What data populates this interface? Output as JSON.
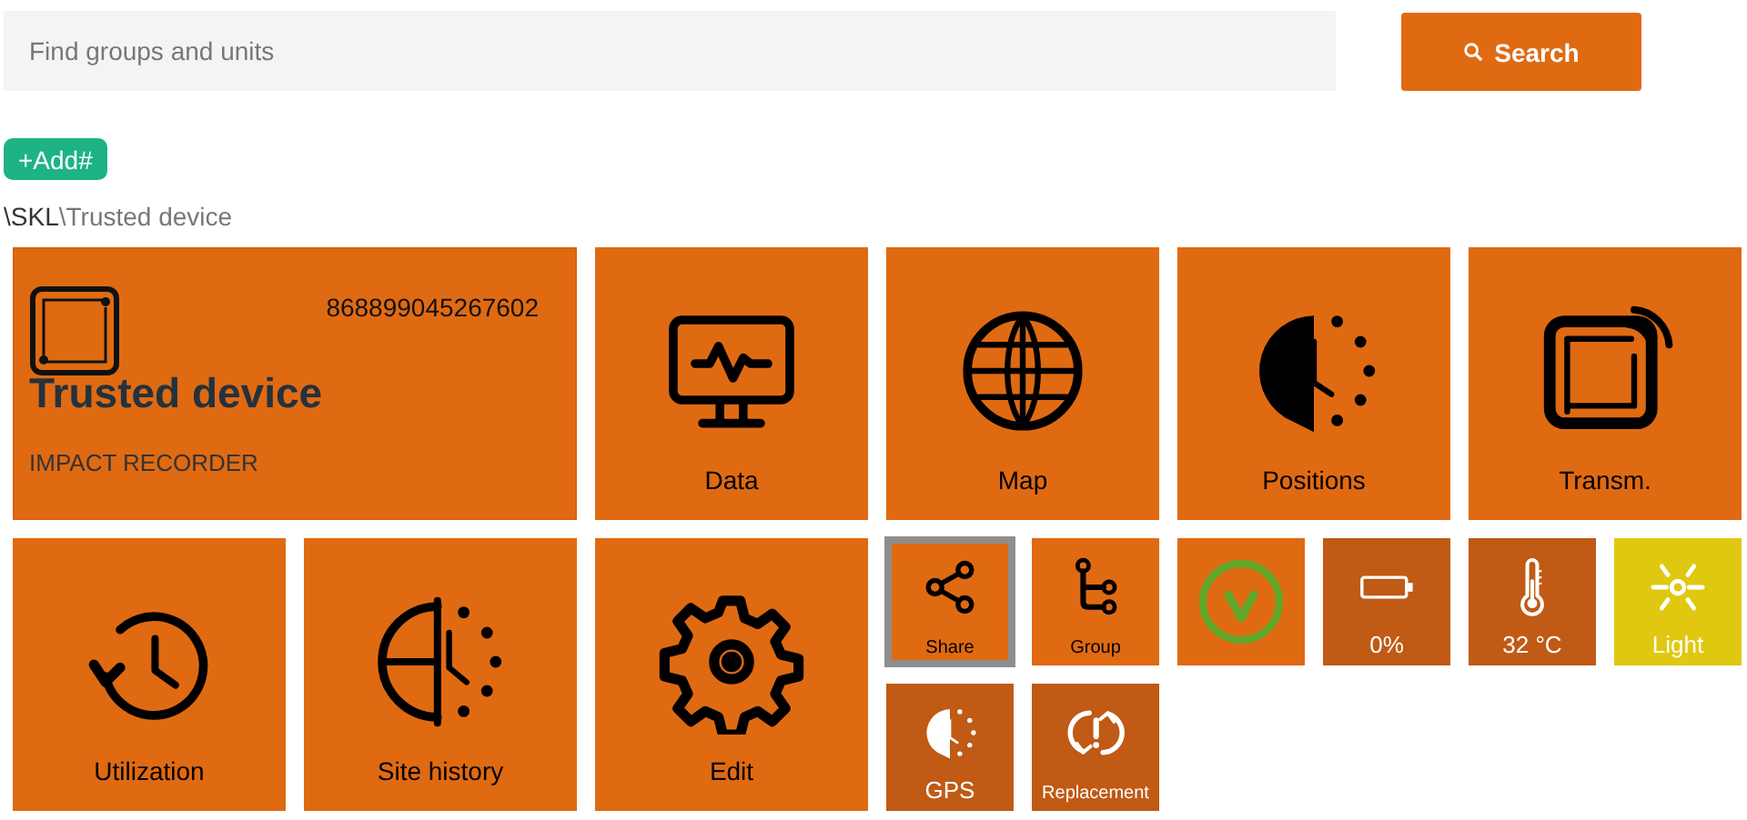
{
  "search": {
    "placeholder": "Find groups and units",
    "button": "Search"
  },
  "add_button": "+Add#",
  "breadcrumb": [
    {
      "label": "\\SKL",
      "selected": false
    },
    {
      "label": "\\Trusted device",
      "selected": true
    }
  ],
  "device": {
    "serial": "868899045267602",
    "name": "Trusted device",
    "type": "IMPACT RECORDER"
  },
  "tiles": [
    {
      "label": "Data",
      "kind": "large",
      "color": "#e06a12",
      "selected": false
    },
    {
      "label": "Map",
      "kind": "large",
      "color": "#e06a12",
      "selected": false
    },
    {
      "label": "Positions",
      "kind": "large",
      "color": "#e06a12",
      "selected": false
    },
    {
      "label": "Transm.",
      "kind": "large",
      "color": "#e06a12",
      "selected": false
    },
    {
      "label": "Utilization",
      "kind": "large",
      "color": "#e06a12",
      "selected": false
    },
    {
      "label": "Site history",
      "kind": "large",
      "color": "#e06a12",
      "selected": false
    },
    {
      "label": "Edit",
      "kind": "large",
      "color": "#e06a12",
      "selected": false
    },
    {
      "label": "Share",
      "kind": "small",
      "color": "#e06a12",
      "selected": true
    },
    {
      "label": "Group",
      "kind": "small",
      "color": "#e06a12",
      "selected": false
    },
    {
      "kind": "small",
      "color": "#e06a12",
      "selected": false
    },
    {
      "label": "0%",
      "kind": "small",
      "color": "#c05a15",
      "selected": false
    },
    {
      "label": "32 °C",
      "kind": "small",
      "color": "#c05a15",
      "selected": false
    },
    {
      "label": "Light",
      "kind": "small",
      "color": "#e0c810",
      "selected": false
    },
    {
      "label": "GPS",
      "kind": "small",
      "color": "#c05a15",
      "selected": false
    },
    {
      "label": "Replacement",
      "kind": "small",
      "color": "#c05a15",
      "selected": false
    }
  ]
}
